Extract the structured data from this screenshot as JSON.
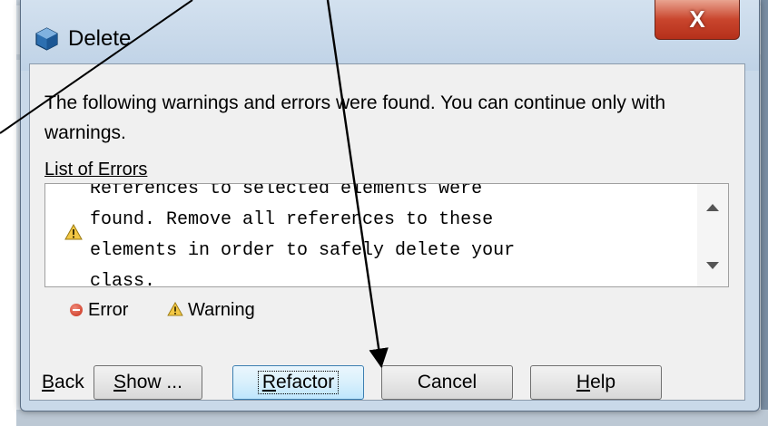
{
  "dialog": {
    "title": "Delete",
    "close_glyph": "X",
    "message": "The following warnings and errors were found. You can continue only with warnings.",
    "list_label_first": "L",
    "list_label_rest": "ist of Errors",
    "error_text": "References to selected elements were\nfound. Remove all references to these\nelements in order to safely delete your\nclass.",
    "legend": {
      "error": "Error",
      "warning": "Warning"
    },
    "buttons": {
      "back_first": "B",
      "back_rest": "ack",
      "show_first": "S",
      "show_rest": "how ...",
      "refactor_first": "R",
      "refactor_rest": "efactor",
      "cancel": "Cancel",
      "help_first": "H",
      "help_rest": "elp"
    }
  }
}
